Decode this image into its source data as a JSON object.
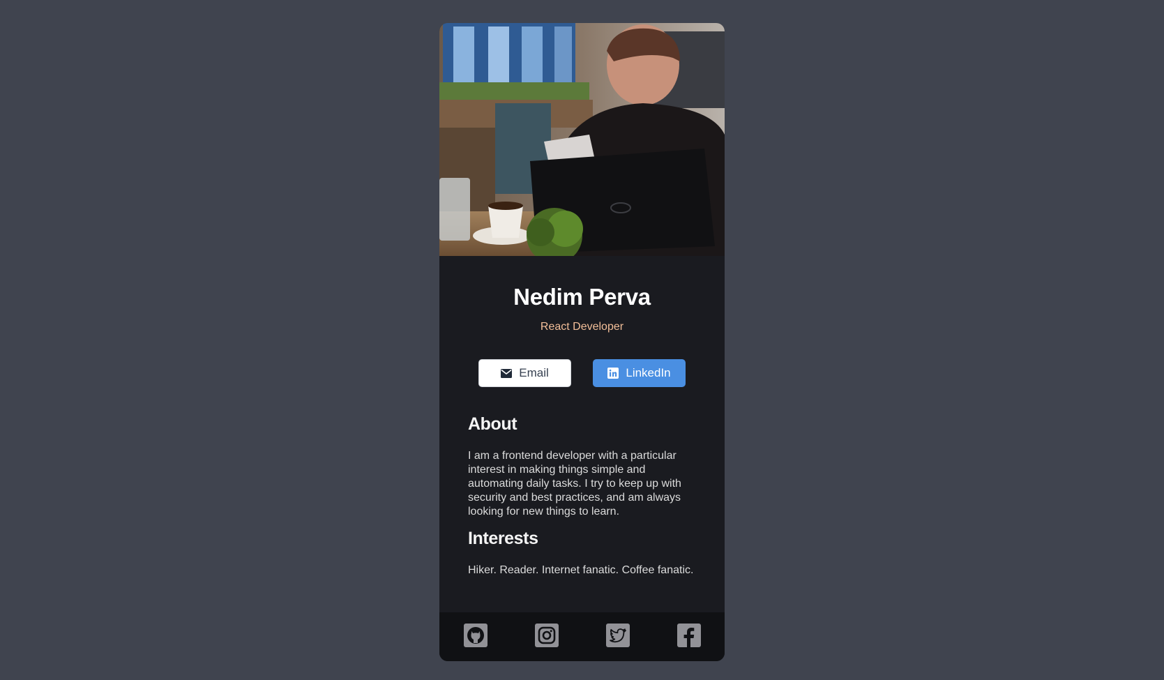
{
  "profile": {
    "name": "Nedim Perva",
    "role": "React Developer",
    "photo_icon": "profile-photo"
  },
  "actions": {
    "email_label": "Email",
    "email_icon": "mail-icon",
    "linkedin_label": "LinkedIn",
    "linkedin_icon": "linkedin-icon"
  },
  "about": {
    "heading": "About",
    "text": "I am a frontend developer with a particular interest in making things simple and automating daily tasks. I try to keep up with security and best practices, and am always looking for new things to learn."
  },
  "interests": {
    "heading": "Interests",
    "text": "Hiker. Reader. Internet fanatic. Coffee fanatic."
  },
  "footer": {
    "icons": [
      "github-icon",
      "instagram-icon",
      "twitter-icon",
      "facebook-icon"
    ]
  },
  "colors": {
    "page_background": "#40444f",
    "card_background": "#1a1b20",
    "role_accent": "#f3bf99",
    "linkedin_button": "#4a8fe2",
    "footer_background": "#101114"
  }
}
